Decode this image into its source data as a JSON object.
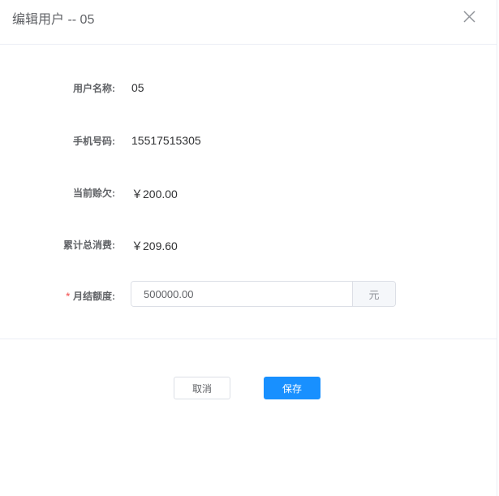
{
  "dialog": {
    "title": "编辑用户 -- 05"
  },
  "form": {
    "username_label": "用户名称:",
    "username": "05",
    "phone_label": "手机号码:",
    "phone": "15517515305",
    "debt_label": "当前赊欠:",
    "debt": "￥200.00",
    "total_label": "累计总消费:",
    "total": "￥209.60",
    "required_mark": "*",
    "limit_label": "月结额度:",
    "limit_value": "500000.00",
    "limit_unit": "元"
  },
  "footer": {
    "cancel_label": "取消",
    "save_label": "保存"
  }
}
